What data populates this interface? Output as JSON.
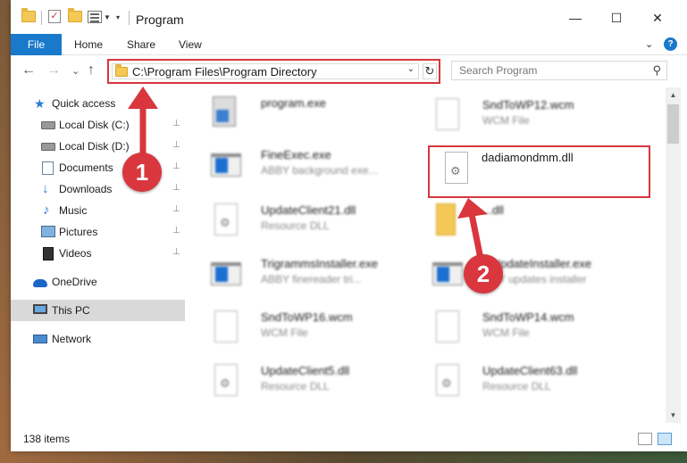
{
  "window": {
    "title": "Program",
    "controls": {
      "minimize": "—",
      "maximize": "☐",
      "close": "✕"
    }
  },
  "ribbon": {
    "tabs": [
      "File",
      "Home",
      "Share",
      "View"
    ],
    "expand_glyph": "⌄",
    "help_glyph": "?"
  },
  "navigation": {
    "back": "←",
    "forward": "→",
    "recent": "⌄",
    "up": "↑",
    "address": "C:\\Program Files\\Program Directory",
    "address_dropdown": "⌄",
    "refresh": "↻",
    "search_placeholder": "Search Program",
    "search_glyph": "⚲"
  },
  "sidebar": {
    "items": [
      {
        "label": "Quick access",
        "icon": "quick-access-star-icon",
        "pinned": false
      },
      {
        "label": "Local Disk (C:)",
        "icon": "local-disk-icon",
        "pinned": true
      },
      {
        "label": "Local Disk (D:)",
        "icon": "local-disk-icon",
        "pinned": true
      },
      {
        "label": "Documents",
        "icon": "documents-icon",
        "pinned": true
      },
      {
        "label": "Downloads",
        "icon": "downloads-icon",
        "pinned": true
      },
      {
        "label": "Music",
        "icon": "music-icon",
        "pinned": true
      },
      {
        "label": "Pictures",
        "icon": "pictures-icon",
        "pinned": true
      },
      {
        "label": "Videos",
        "icon": "videos-icon",
        "pinned": true
      },
      {
        "label": "OneDrive",
        "icon": "onedrive-icon",
        "pinned": false
      },
      {
        "label": "This PC",
        "icon": "this-pc-icon",
        "pinned": false,
        "selected": true
      },
      {
        "label": "Network",
        "icon": "network-icon",
        "pinned": false
      }
    ],
    "pin_glyph": "📌"
  },
  "files": {
    "left_column": [
      {
        "name": "program.exe",
        "type": "",
        "icon": "program-exe-icon"
      },
      {
        "name": "FineExec.exe",
        "type": "ABBY background exe...",
        "icon": "exe-icon"
      },
      {
        "name": "UpdateClient21.dll",
        "type": "Resource DLL",
        "icon": "dll-icon"
      },
      {
        "name": "TrigrammsInstaller.exe",
        "type": "ABBY finereader tri...",
        "icon": "exe-icon"
      },
      {
        "name": "SndToWP16.wcm",
        "type": "WCM File",
        "icon": "document-icon"
      },
      {
        "name": "UpdateClient5.dll",
        "type": "Resource DLL",
        "icon": "dll-icon"
      }
    ],
    "right_column": [
      {
        "name": "SndToWP12.wcm",
        "type": "WCM File",
        "icon": "document-icon"
      },
      {
        "name": "dadiamondmm.dll",
        "type": "",
        "icon": "dll-icon",
        "highlighted": true
      },
      {
        "name": "...dll",
        "type": "",
        "icon": "zip-folder-icon"
      },
      {
        "name": "...UpdateInstaller.exe",
        "type": "...BY updates installer",
        "icon": "exe-icon"
      },
      {
        "name": "SndToWP14.wcm",
        "type": "WCM File",
        "icon": "document-icon"
      },
      {
        "name": "UpdateClient63.dll",
        "type": "Resource DLL",
        "icon": "dll-icon"
      }
    ]
  },
  "status": {
    "item_count": "138 items"
  },
  "annotations": {
    "step1": "1",
    "step2": "2",
    "color": "#d9363e"
  },
  "colors": {
    "accent": "#1979ca",
    "highlight": "#d9363e",
    "selected_bg": "#d9d9d9"
  }
}
